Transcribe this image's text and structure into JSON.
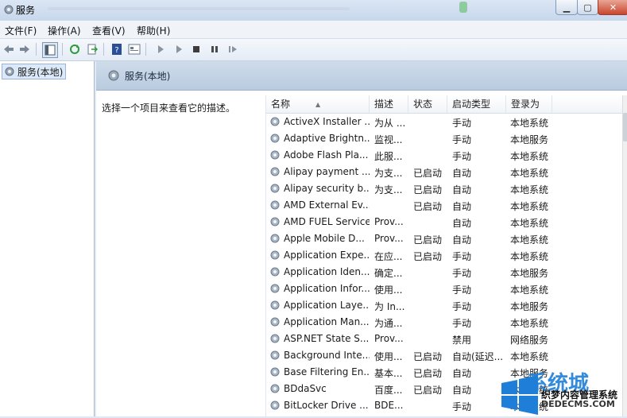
{
  "window": {
    "title": "服务"
  },
  "menu": [
    "文件(F)",
    "操作(A)",
    "查看(V)",
    "帮助(H)"
  ],
  "toolbar_icons": [
    "back-icon",
    "forward-icon",
    "show-hide-tree-icon",
    "refresh-icon",
    "export-icon",
    "help-icon",
    "properties-icon",
    "start-icon",
    "start-alt-icon",
    "stop-icon",
    "pause-icon",
    "resume-icon"
  ],
  "tree": {
    "root_label": "服务(本地)"
  },
  "section": {
    "title": "服务(本地)",
    "description_hint": "选择一个项目来查看它的描述。"
  },
  "columns": {
    "name": "名称",
    "desc": "描述",
    "status": "状态",
    "startup": "启动类型",
    "logon": "登录为"
  },
  "services": [
    {
      "name": "ActiveX Installer ...",
      "desc": "为从 ...",
      "status": "",
      "startup": "手动",
      "logon": "本地系统"
    },
    {
      "name": "Adaptive Brightn...",
      "desc": "监视...",
      "status": "",
      "startup": "手动",
      "logon": "本地服务"
    },
    {
      "name": "Adobe Flash Pla...",
      "desc": "此服...",
      "status": "",
      "startup": "手动",
      "logon": "本地系统"
    },
    {
      "name": "Alipay payment ...",
      "desc": "为支...",
      "status": "已启动",
      "startup": "自动",
      "logon": "本地系统"
    },
    {
      "name": "Alipay security b...",
      "desc": "为支...",
      "status": "已启动",
      "startup": "自动",
      "logon": "本地系统"
    },
    {
      "name": "AMD External Ev...",
      "desc": "",
      "status": "已启动",
      "startup": "自动",
      "logon": "本地系统"
    },
    {
      "name": "AMD FUEL Service",
      "desc": "Prov...",
      "status": "",
      "startup": "自动",
      "logon": "本地系统"
    },
    {
      "name": "Apple Mobile D...",
      "desc": "Prov...",
      "status": "已启动",
      "startup": "自动",
      "logon": "本地系统"
    },
    {
      "name": "Application Expe...",
      "desc": "在应...",
      "status": "已启动",
      "startup": "手动",
      "logon": "本地系统"
    },
    {
      "name": "Application Iden...",
      "desc": "确定...",
      "status": "",
      "startup": "手动",
      "logon": "本地服务"
    },
    {
      "name": "Application Infor...",
      "desc": "使用...",
      "status": "",
      "startup": "手动",
      "logon": "本地系统"
    },
    {
      "name": "Application Laye...",
      "desc": "为 In...",
      "status": "",
      "startup": "手动",
      "logon": "本地服务"
    },
    {
      "name": "Application Man...",
      "desc": "为通...",
      "status": "",
      "startup": "手动",
      "logon": "本地系统"
    },
    {
      "name": "ASP.NET State S...",
      "desc": "Prov...",
      "status": "",
      "startup": "禁用",
      "logon": "网络服务"
    },
    {
      "name": "Background Inte...",
      "desc": "使用...",
      "status": "已启动",
      "startup": "自动(延迟...",
      "logon": "本地系统"
    },
    {
      "name": "Base Filtering En...",
      "desc": "基本...",
      "status": "已启动",
      "startup": "自动",
      "logon": "本地服务"
    },
    {
      "name": "BDdaSvc",
      "desc": "百度...",
      "status": "已启动",
      "startup": "自动",
      "logon": "本地系统"
    },
    {
      "name": "BitLocker Drive ...",
      "desc": "BDE...",
      "status": "",
      "startup": "手动",
      "logon": "本地系统"
    }
  ],
  "watermark": {
    "brand": "系统城",
    "site_cn": "织梦内容管理系统",
    "site_url": "DEDECMS.COM"
  },
  "colors": {
    "header_gradient_top": "#cfdcea",
    "selection": "#dce9f8",
    "accent": "#1f7fd8"
  }
}
